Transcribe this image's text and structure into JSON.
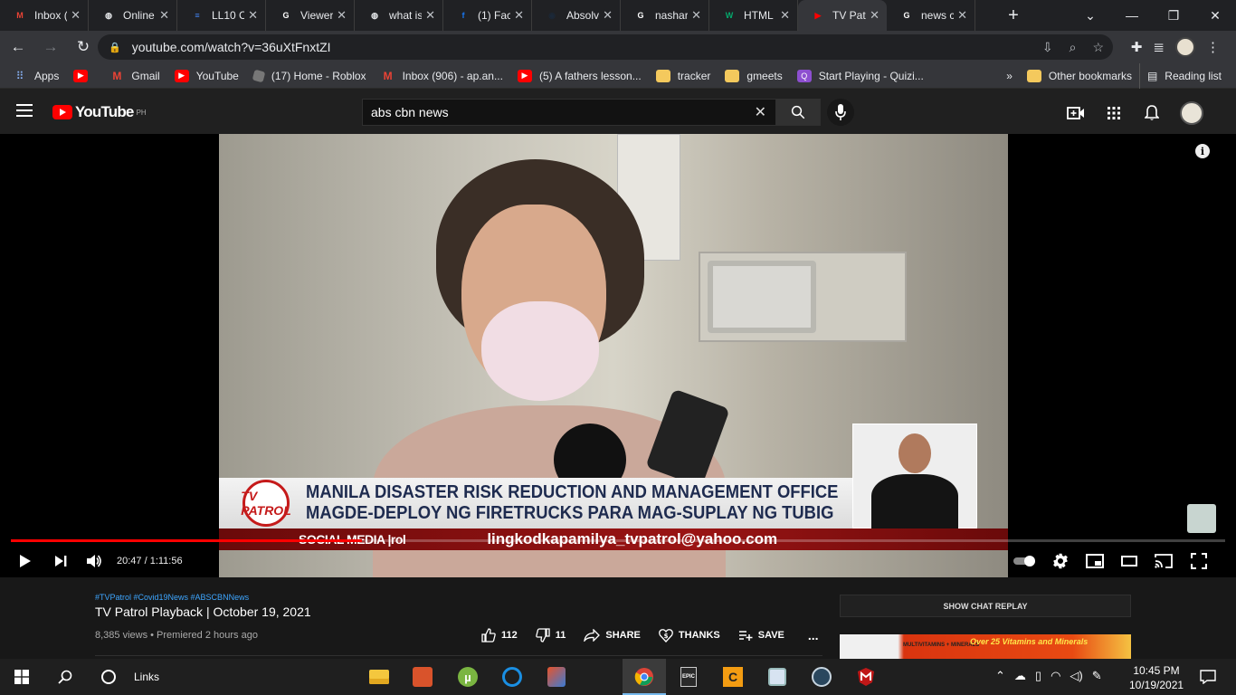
{
  "browser": {
    "tabs": [
      {
        "label": "Inbox (",
        "icon": "gmail-icon",
        "icon_color": "#ea4335",
        "icon_glyph": "M"
      },
      {
        "label": "Online",
        "icon": "globe-icon",
        "icon_color": "#e8eaed",
        "icon_glyph": "◍"
      },
      {
        "label": "LL10 C",
        "icon": "docs-icon",
        "icon_color": "#4285f4",
        "icon_glyph": "≡"
      },
      {
        "label": "Viewer",
        "icon": "google-icon",
        "icon_color": "#ffffff",
        "icon_glyph": "G"
      },
      {
        "label": "what is",
        "icon": "globe-icon",
        "icon_color": "#e8eaed",
        "icon_glyph": "◍"
      },
      {
        "label": "(1) Fac",
        "icon": "facebook-icon",
        "icon_color": "#1877f2",
        "icon_glyph": "f"
      },
      {
        "label": "Absolv",
        "icon": "steam-icon",
        "icon_color": "#1b2838",
        "icon_glyph": "◉"
      },
      {
        "label": "nashar",
        "icon": "google-icon",
        "icon_color": "#ffffff",
        "icon_glyph": "G"
      },
      {
        "label": "HTML",
        "icon": "w3schools-icon",
        "icon_color": "#04aa6d",
        "icon_glyph": "W"
      },
      {
        "label": "TV Pat",
        "icon": "youtube-icon",
        "icon_color": "#ff0000",
        "icon_glyph": "▶",
        "active": true
      },
      {
        "label": "news c",
        "icon": "google-icon",
        "icon_color": "#ffffff",
        "icon_glyph": "G"
      }
    ],
    "url": "youtube.com/watch?v=36uXtFnxtZI",
    "bookmarks": [
      {
        "label": "Apps",
        "icon": "apps-grid-icon"
      },
      {
        "label": "",
        "icon": "youtube-icon"
      },
      {
        "label": "Gmail",
        "icon": "gmail-icon"
      },
      {
        "label": "YouTube",
        "icon": "youtube-icon"
      },
      {
        "label": "(17) Home - Roblox",
        "icon": "roblox-icon"
      },
      {
        "label": "Inbox (906) - ap.an...",
        "icon": "gmail-icon"
      },
      {
        "label": "(5) A fathers lesson...",
        "icon": "youtube-icon"
      },
      {
        "label": "tracker",
        "icon": "folder-icon"
      },
      {
        "label": "gmeets",
        "icon": "folder-icon"
      },
      {
        "label": "Start Playing - Quizi...",
        "icon": "quizizz-icon"
      }
    ],
    "bookmarks_more": "»",
    "other_bookmarks": "Other bookmarks",
    "reading_list": "Reading list"
  },
  "youtube": {
    "logo_text": "YouTube",
    "region": "PH",
    "search_value": "abs cbn news",
    "video": {
      "headline_line1": "MANILA DISASTER RISK REDUCTION AND MANAGEMENT OFFICE",
      "headline_line2": "MAGDE-DEPLOY NG FIRETRUCKS PARA MAG-SUPLAY NG TUBIG",
      "logo_text": "TV PATROL",
      "ticker_left": "SOCIAL MEDIA |rol",
      "ticker_right": "lingkodkapamilya_tvpatrol@yahoo.com",
      "current_time": "20:47",
      "duration": "1:11:56",
      "timecode": "20:47 / 1:11:56",
      "progress_fraction": 0.289
    },
    "hashtags": "#TVPatrol #Covid19News #ABSCBNNews",
    "title": "TV Patrol Playback | October 19, 2021",
    "meta": "8,385 views • Premiered 2 hours ago",
    "likes": "112",
    "dislikes": "11",
    "share_label": "SHARE",
    "thanks_label": "THANKS",
    "save_label": "SAVE",
    "more_label": "...",
    "chat_replay_label": "SHOW CHAT REPLAY",
    "ad_text1": "MULTIVITAMINS + MINERALS",
    "ad_text2": "Over 25 Vitamins and Minerals"
  },
  "taskbar": {
    "links_label": "Links",
    "time": "10:45 PM",
    "date": "10/19/2021"
  },
  "colors": {
    "accent_red": "#ff0000",
    "link_blue": "#3ea6ff",
    "chrome_dark": "#202124"
  }
}
